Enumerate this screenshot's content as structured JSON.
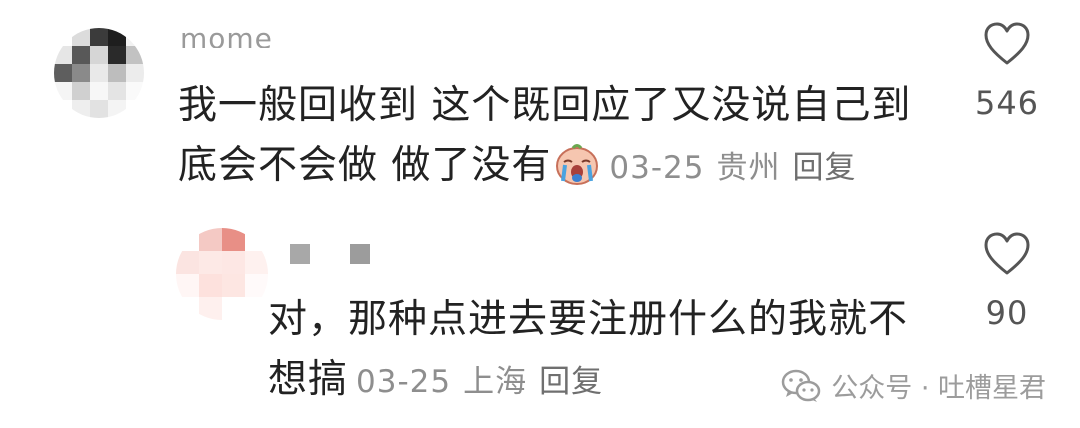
{
  "comments": [
    {
      "username": "mome",
      "text": "我一般回收到 这个既回应了又没说自己到底会不会做 做了没有",
      "emoji": "crying-face-emoji",
      "date": "03-25",
      "location": "贵州",
      "reply_label": "回复",
      "likes": "546"
    },
    {
      "text": "对，那种点进去要注册什么的我就不想搞",
      "date": "03-25",
      "location": "上海",
      "reply_label": "回复",
      "likes": "90"
    }
  ],
  "watermark": {
    "text": "公众号 · 吐槽星君",
    "icon": "wechat-icon"
  },
  "colors": {
    "text": "#222222",
    "meta": "#8e8e8e",
    "heart_outline": "#555555",
    "watermark": "#9c9c9c"
  }
}
